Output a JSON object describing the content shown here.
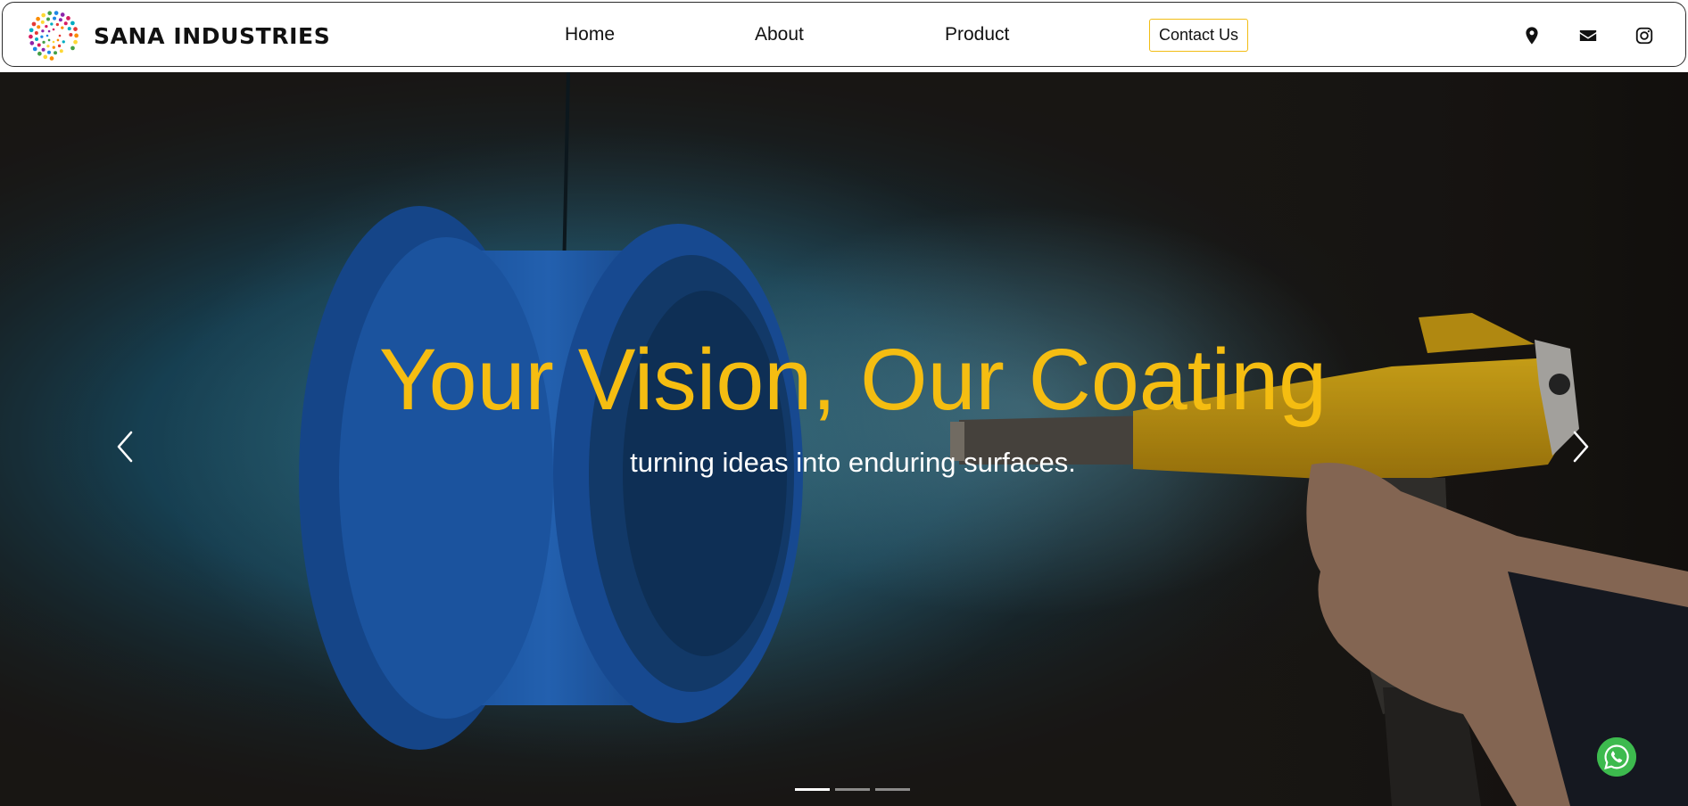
{
  "header": {
    "brand_name": "SANA INDUSTRIES",
    "nav": {
      "home": "Home",
      "about": "About",
      "product": "Product",
      "contact": "Contact Us"
    },
    "icons": [
      "map-marker-icon",
      "envelope-icon",
      "instagram-icon"
    ],
    "contact_border_color": "#f2bd14"
  },
  "hero": {
    "title": "Your Vision, Our Coating",
    "subtitle": "turning ideas into enduring surfaces.",
    "title_color": "#f5bd11",
    "subtitle_color": "#ffffff",
    "slide_count": 3,
    "active_slide": 1,
    "prev_icon": "chevron-left-icon",
    "next_icon": "chevron-right-icon"
  },
  "floating": {
    "whatsapp_icon": "whatsapp-icon",
    "whatsapp_color": "#3dba4e"
  }
}
